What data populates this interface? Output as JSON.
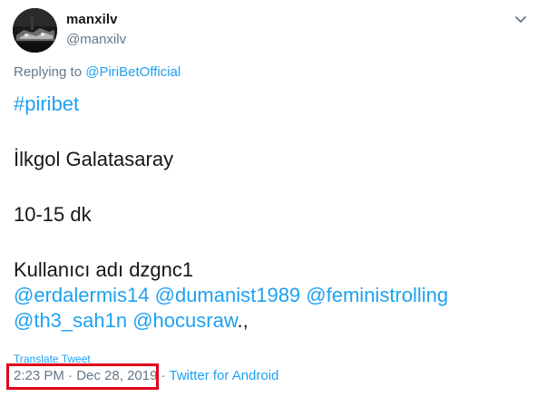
{
  "author": {
    "display_name": "manxilv",
    "handle": "@manxilv"
  },
  "reply": {
    "prefix": "Replying to ",
    "to": "@PiriBetOfficial"
  },
  "tweet": {
    "hashtag": "#piribet",
    "line2": "İlkgol Galatasaray",
    "line3": "10-15 dk",
    "line4": "Kullanıcı adı dzgnc1",
    "mentions": [
      "@erdalermis14",
      "@dumanist1989",
      "@feministrolling",
      "@th3_sah1n",
      "@hocusraw"
    ],
    "trailing": ".,"
  },
  "translate_label": "Translate Tweet",
  "meta": {
    "time": "2:23 PM",
    "separator": " · ",
    "date": "Dec 28, 2019",
    "source": "Twitter for Android"
  },
  "colors": {
    "link": "#1da1f2",
    "muted": "#657786",
    "text": "#14171a",
    "highlight": "#e0001b"
  },
  "icons": {
    "more": "chevron-down-icon"
  }
}
